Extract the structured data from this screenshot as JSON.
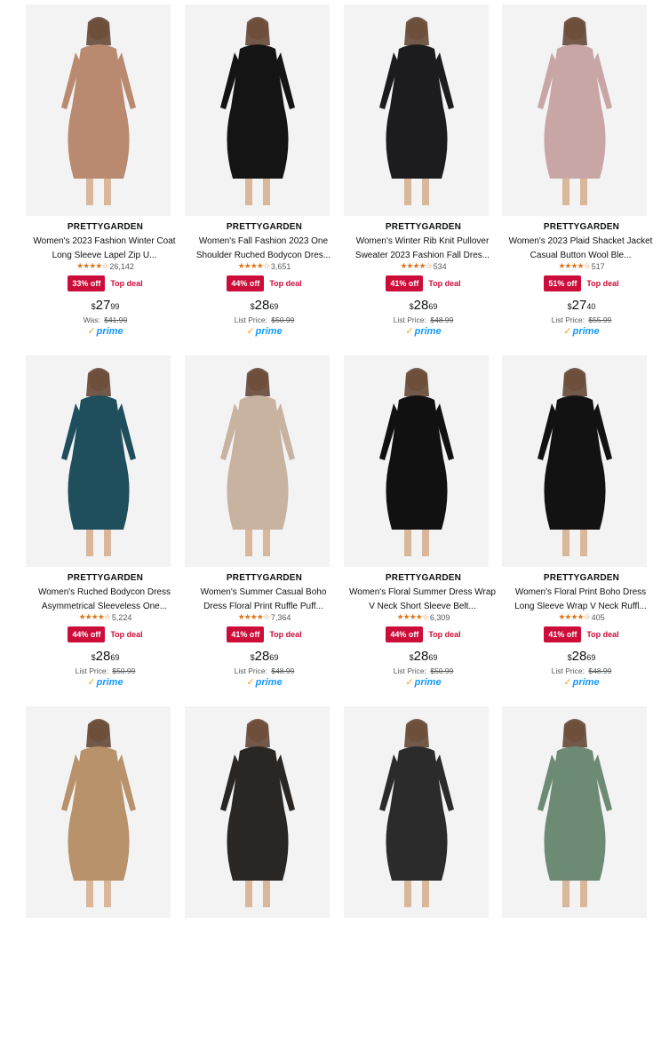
{
  "colors": {
    "deal_red": "#cc0c39",
    "star_orange": "#de7921",
    "prime_blue": "#1399ff",
    "image_bg": "#f3f3f4"
  },
  "products": [
    {
      "brand": "PRETTYGARDEN",
      "title": "Women's 2023 Fashion Winter Coat Long Sleeve Lapel Zip U...",
      "reviews": "26,142",
      "discount": "33% off",
      "deal": "Top deal",
      "price_symbol": "$",
      "price_whole": "27",
      "price_cents": "99",
      "list_label": "Was:",
      "list_price": "$41.99",
      "prime": "prime",
      "image_icon": "teddy-coat-model-icon",
      "garment_color": "#b98a70"
    },
    {
      "brand": "PRETTYGARDEN",
      "title": "Women's Fall Fashion 2023 One Shoulder Ruched Bodycon Dres...",
      "reviews": "3,651",
      "discount": "44% off",
      "deal": "Top deal",
      "price_symbol": "$",
      "price_whole": "28",
      "price_cents": "69",
      "list_label": "List Price:",
      "list_price": "$50.99",
      "prime": "prime",
      "image_icon": "black-bodycon-dress-icon",
      "garment_color": "#141414"
    },
    {
      "brand": "PRETTYGARDEN",
      "title": "Women's Winter Rib Knit Pullover Sweater 2023 Fashion Fall Dres...",
      "reviews": "534",
      "discount": "41% off",
      "deal": "Top deal",
      "price_symbol": "$",
      "price_whole": "28",
      "price_cents": "69",
      "list_label": "List Price:",
      "list_price": "$48.99",
      "prime": "prime",
      "image_icon": "knit-sweater-dress-icon",
      "garment_color": "#1c1c1e"
    },
    {
      "brand": "PRETTYGARDEN",
      "title": "Women's 2023 Plaid Shacket Jacket Casual Button Wool Ble...",
      "reviews": "517",
      "discount": "51% off",
      "deal": "Top deal",
      "price_symbol": "$",
      "price_whole": "27",
      "price_cents": "40",
      "list_label": "List Price:",
      "list_price": "$55.99",
      "prime": "prime",
      "image_icon": "plaid-shacket-icon",
      "garment_color": "#c9a6a6"
    },
    {
      "brand": "PRETTYGARDEN",
      "title": "Women's Ruched Bodycon Dress Asymmetrical Sleeveless One...",
      "reviews": "5,224",
      "discount": "44% off",
      "deal": "Top deal",
      "price_symbol": "$",
      "price_whole": "28",
      "price_cents": "69",
      "list_label": "List Price:",
      "list_price": "$50.99",
      "prime": "prime",
      "image_icon": "teal-ruched-dress-icon",
      "garment_color": "#1f4f5c"
    },
    {
      "brand": "PRETTYGARDEN",
      "title": "Women's Summer Casual Boho Dress Floral Print Ruffle Puff...",
      "reviews": "7,364",
      "discount": "41% off",
      "deal": "Top deal",
      "price_symbol": "$",
      "price_whole": "28",
      "price_cents": "69",
      "list_label": "List Price:",
      "list_price": "$48.99",
      "prime": "prime",
      "image_icon": "boho-floral-dress-icon",
      "garment_color": "#c8b2a0"
    },
    {
      "brand": "PRETTYGARDEN",
      "title": "Women's Floral Summer Dress Wrap V Neck Short Sleeve Belt...",
      "reviews": "6,309",
      "discount": "44% off",
      "deal": "Top deal",
      "price_symbol": "$",
      "price_whole": "28",
      "price_cents": "69",
      "list_label": "List Price:",
      "list_price": "$50.99",
      "prime": "prime",
      "image_icon": "black-wrap-dress-icon",
      "garment_color": "#111111"
    },
    {
      "brand": "PRETTYGARDEN",
      "title": "Women's Floral Print Boho Dress Long Sleeve Wrap V Neck Ruffl...",
      "reviews": "405",
      "discount": "41% off",
      "deal": "Top deal",
      "price_symbol": "$",
      "price_whole": "28",
      "price_cents": "69",
      "list_label": "List Price:",
      "list_price": "$48.99",
      "prime": "prime",
      "image_icon": "long-sleeve-boho-dress-icon",
      "garment_color": "#121212"
    },
    {
      "image_icon": "leopard-sweater-dress-icon",
      "garment_color": "#b8926a"
    },
    {
      "image_icon": "leopard-maxi-dress-icon",
      "garment_color": "#2a2623"
    },
    {
      "image_icon": "chevron-cardigan-icon",
      "garment_color": "#2b2b2b"
    },
    {
      "image_icon": "green-jumpsuit-icon",
      "garment_color": "#6c8a74"
    }
  ]
}
